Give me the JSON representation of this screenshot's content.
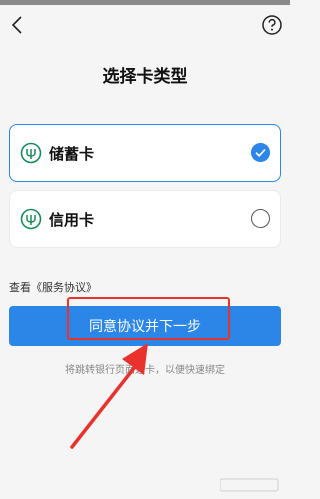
{
  "header": {
    "back_icon": "chevron-left-icon",
    "help_icon": "question-circle-icon",
    "title": "选择卡类型"
  },
  "cards": [
    {
      "label": "储蓄卡",
      "selected": true,
      "icon": "bank-logo-icon"
    },
    {
      "label": "信用卡",
      "selected": false,
      "icon": "bank-logo-icon"
    }
  ],
  "agreement": {
    "prefix": "查看",
    "link": "《服务协议》"
  },
  "primary_button": {
    "label": "同意协议并下一步"
  },
  "hint": "将跳转银行页面选卡，以便快速绑定",
  "annotation": {
    "highlight_color": "#e8322b",
    "arrow_color": "#e8322b"
  },
  "colors": {
    "accent": "#2b86e8",
    "bank_green": "#1a8a5a"
  }
}
